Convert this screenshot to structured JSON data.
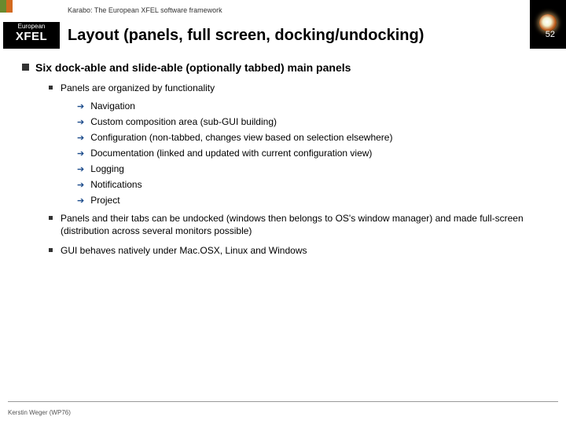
{
  "meta": {
    "framework_tag": "Karabo: The European XFEL software framework",
    "logo_line1": "European",
    "logo_line2": "XFEL",
    "page_number": "52"
  },
  "title": "Layout (panels, full screen, docking/undocking)",
  "content": {
    "h1": "Six dock-able and slide-able (optionally tabbed) main panels",
    "l2_a": "Panels are organized by functionality",
    "l3_items": [
      "Navigation",
      "Custom composition area (sub-GUI building)",
      "Configuration (non-tabbed, changes view based on selection elsewhere)",
      "Documentation (linked and updated with current configuration view)",
      "Logging",
      "Notifications",
      "Project"
    ],
    "l2_b": "Panels and their tabs can be undocked (windows then belongs to OS's window manager) and made full-screen (distribution across several monitors possible)",
    "l2_c": "GUI behaves natively under Mac.OSX, Linux and Windows"
  },
  "footer": "Kerstin Weger (WP76)"
}
